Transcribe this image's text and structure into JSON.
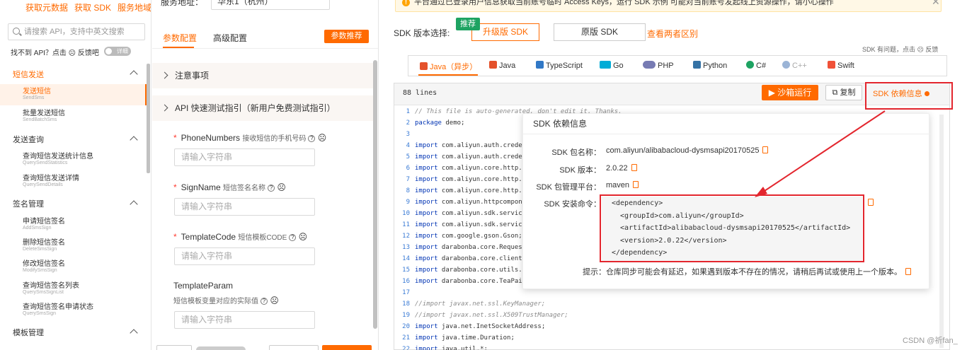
{
  "sidebar": {
    "top_links": [
      "获取元数据",
      "获取 SDK",
      "服务地域"
    ],
    "search_placeholder": "请搜索 API，支持中英文搜索",
    "not_found": "找不到 API？点击 ☹ 反馈吧",
    "toggle": "详细",
    "groups": [
      {
        "label": "短信发送",
        "items": [
          {
            "name": "发送短信",
            "api": "SendSms"
          },
          {
            "name": "批量发送短信",
            "api": "SendBatchSms"
          }
        ]
      },
      {
        "label": "发送查询",
        "items": [
          {
            "name": "查询短信发送统计信息",
            "api": "QuerySendStatistics"
          },
          {
            "name": "查询短信发送详情",
            "api": "QuerySendDetails"
          }
        ]
      },
      {
        "label": "签名管理",
        "items": [
          {
            "name": "申请短信签名",
            "api": "AddSmsSign"
          },
          {
            "name": "删除短信签名",
            "api": "DeleteSmsSign"
          },
          {
            "name": "修改短信签名",
            "api": "ModifySmsSign"
          },
          {
            "name": "查询短信签名列表",
            "api": "QuerySmsSignList"
          },
          {
            "name": "查询短信签名申请状态",
            "api": "QuerySmsSign"
          }
        ]
      },
      {
        "label": "模板管理",
        "items": []
      }
    ]
  },
  "params": {
    "service_label": "服务地址：",
    "region": "华东1（杭州）",
    "tabs": [
      "参数配置",
      "高级配置"
    ],
    "recommend_btn": "参数推荐",
    "acc1": "注意事项",
    "acc2": "API 快速测试指引（新用户免费测试指引）",
    "fields": [
      {
        "name": "PhoneNumbers",
        "desc": "接收短信的手机号码",
        "required": "*",
        "placeholder": "请输入字符串"
      },
      {
        "name": "SignName",
        "desc": "短信签名名称",
        "required": "*",
        "placeholder": "请输入字符串"
      },
      {
        "name": "TemplateCode",
        "desc": "短信模板CODE",
        "required": "*",
        "placeholder": "请输入字符串"
      },
      {
        "name": "TemplateParam",
        "desc": "短信模板变量对应的实际值",
        "required": "",
        "placeholder": "请输入字符串"
      }
    ]
  },
  "sdk": {
    "warning": "平台通过已登录用户信息获取当前账号临时 Access Keys，运行 SDK 示例 可能对当前账号发起线上资源操作，请小心操作",
    "version_label": "SDK 版本选择:",
    "recommend_tag": "推荐",
    "upgrade_btn": "升级版 SDK",
    "original_btn": "原版 SDK",
    "compare_link": "查看两者区别",
    "feedback": "SDK 有问题，点击 ☹ 反馈",
    "languages": [
      "Java（异步）",
      "Java",
      "TypeScript",
      "Go",
      "PHP",
      "Python",
      "C#",
      "C++",
      "Swift"
    ],
    "lines": "88 lines",
    "run_btn": "沙箱运行",
    "copy_btn": "复制",
    "dep_btn": "SDK 依赖信息",
    "code": [
      {
        "n": "1",
        "t": "// This file is auto-generated, don't edit it. Thanks."
      },
      {
        "n": "2",
        "t": "package demo;"
      },
      {
        "n": "3",
        "t": ""
      },
      {
        "n": "4",
        "t": "import com.aliyun.auth.creden"
      },
      {
        "n": "5",
        "t": "import com.aliyun.auth.creden"
      },
      {
        "n": "6",
        "t": "import com.aliyun.core.http.H"
      },
      {
        "n": "7",
        "t": "import com.aliyun.core.http.H"
      },
      {
        "n": "8",
        "t": "import com.aliyun.core.http.F"
      },
      {
        "n": "9",
        "t": "import com.aliyun.httpcompone"
      },
      {
        "n": "10",
        "t": "import com.aliyun.sdk.service"
      },
      {
        "n": "11",
        "t": "import com.aliyun.sdk.service"
      },
      {
        "n": "12",
        "t": "import com.google.gson.Gson;"
      },
      {
        "n": "13",
        "t": "import darabonba.core.Request"
      },
      {
        "n": "14",
        "t": "import darabonba.core.client."
      },
      {
        "n": "15",
        "t": "import darabonba.core.utils.C"
      },
      {
        "n": "16",
        "t": "import darabonba.core.TeaPair"
      },
      {
        "n": "17",
        "t": ""
      },
      {
        "n": "18",
        "t": "//import javax.net.ssl.KeyManager;"
      },
      {
        "n": "19",
        "t": "//import javax.net.ssl.X509TrustManager;"
      },
      {
        "n": "20",
        "t": "import java.net.InetSocketAddress;"
      },
      {
        "n": "21",
        "t": "import java.time.Duration;"
      },
      {
        "n": "22",
        "t": "import java.util.*;"
      }
    ]
  },
  "popup": {
    "title": "SDK 依赖信息",
    "pkg_label": "SDK 包名称：",
    "pkg": "com.aliyun/alibabacloud-dysmsapi20170525",
    "ver_label": "SDK 版本：",
    "ver": "2.0.22",
    "mgr_label": "SDK 包管理平台：",
    "mgr": "maven",
    "cmd_label": "SDK 安装命令：",
    "xml": [
      "<dependency>",
      "  <groupId>com.aliyun</groupId>",
      "  <artifactId>alibabacloud-dysmsapi20170525</artifactId>",
      "  <version>2.0.22</version>",
      "</dependency>"
    ],
    "tip": "提示：仓库同步可能会有延迟，如果遇到版本不存在的情况，请稍后再试或使用上一个版本。"
  },
  "watermark": "CSDN @祈fan_"
}
